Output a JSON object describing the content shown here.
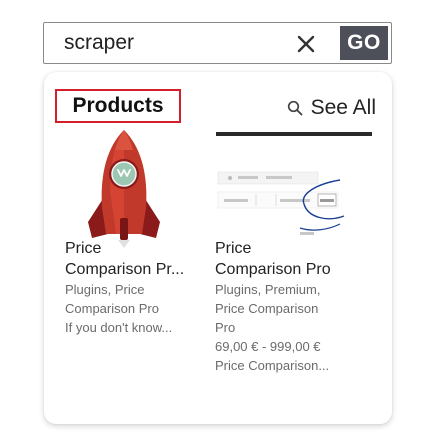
{
  "search": {
    "value": "scraper",
    "clear_icon": "close-icon",
    "go_label": "GO"
  },
  "results": {
    "section_title": "Products",
    "see_all_label": "See All",
    "see_all_icon": "search-icon",
    "items": [
      {
        "label": "Price",
        "title": "Comparison Pr...",
        "meta_lines": [
          "Plugins, Price",
          "Comparison Pro"
        ],
        "description": "If you don't know...",
        "thumbnail_icon": "rocket-icon"
      },
      {
        "label": "Price",
        "title": "Comparison Pro",
        "meta_lines": [
          "Plugins, Premium,",
          "Price Comparison",
          "Pro"
        ],
        "price": "69,00 € - 999,00 €",
        "description": "Price Comparison...",
        "thumbnail_icon": "table-screenshot-icon"
      }
    ]
  },
  "colors": {
    "go_button_bg": "#4d5058",
    "highlight_border": "#d21f2b",
    "rocket_red": "#c0392b",
    "rocket_dark_red": "#8b1a1a"
  }
}
